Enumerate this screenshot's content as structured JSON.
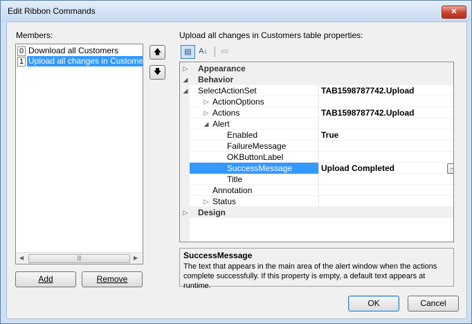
{
  "window": {
    "title": "Edit Ribbon Commands",
    "close_label": "✕"
  },
  "members": {
    "label": "Members:",
    "items": [
      {
        "index": "0",
        "text": "Download all Customers"
      },
      {
        "index": "1",
        "text": "Upload all changes in Customers"
      }
    ],
    "scroll_thumb_glyph": "|||",
    "add_label": "Add",
    "remove_label": "Remove",
    "up_glyph": "🡅",
    "down_glyph": "🡇"
  },
  "properties": {
    "label": "Upload all changes in Customers table properties:",
    "toolbar": {
      "categorized_glyph": "▤",
      "alphabetical_glyph": "A↓",
      "pages_glyph": "▭"
    },
    "rows": {
      "appearance": "Appearance",
      "behavior": "Behavior",
      "select_action_set": {
        "name": "SelectActionSet",
        "value": "TAB1598787742.Upload"
      },
      "action_options": {
        "name": "ActionOptions",
        "value": ""
      },
      "actions": {
        "name": "Actions",
        "value": "TAB1598787742.Upload"
      },
      "alert": {
        "name": "Alert",
        "value": ""
      },
      "enabled": {
        "name": "Enabled",
        "value": "True"
      },
      "failure_message": {
        "name": "FailureMessage",
        "value": ""
      },
      "ok_button_label": {
        "name": "OKButtonLabel",
        "value": ""
      },
      "success_message": {
        "name": "SuccessMessage",
        "value": "Upload Completed"
      },
      "title": {
        "name": "Title",
        "value": ""
      },
      "annotation": {
        "name": "Annotation",
        "value": ""
      },
      "status": {
        "name": "Status",
        "value": ""
      },
      "design": "Design"
    },
    "ellipsis_label": "...",
    "description": {
      "title": "SuccessMessage",
      "text": "The text that appears in the main area of the alert window when the actions complete successfully. If this property is empty, a default text appears at runtime."
    }
  },
  "footer": {
    "ok_label": "OK",
    "cancel_label": "Cancel"
  }
}
